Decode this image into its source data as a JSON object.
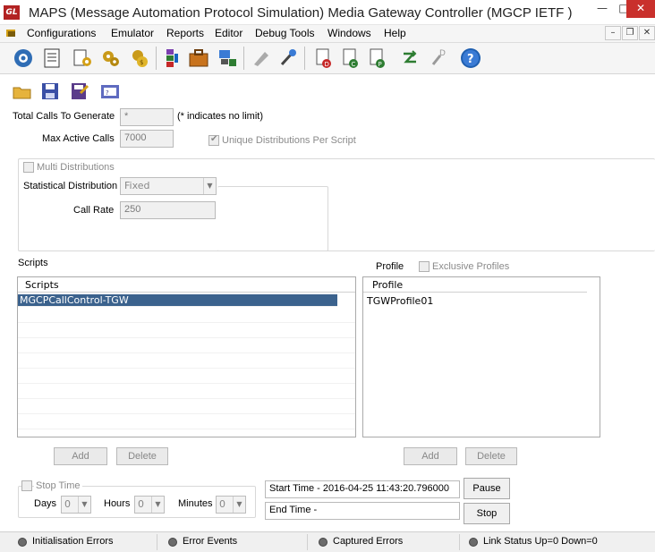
{
  "window": {
    "title": "MAPS (Message Automation Protocol Simulation) Media Gateway Controller (MGCP IETF )",
    "logo_text": "GL",
    "min": "—",
    "max": "□",
    "close": "✕"
  },
  "menu": {
    "items": [
      "Configurations",
      "Emulator",
      "Reports",
      "Editor",
      "Debug Tools",
      "Windows",
      "Help"
    ],
    "mdi_min": "–",
    "mdi_restore": "❐",
    "mdi_close": "✕"
  },
  "toolbar": {
    "icons": [
      "settings-gear-icon",
      "script-document-icon",
      "edit-script-icon",
      "gears-icon",
      "coins-gears-icon",
      "profile-blocks-icon",
      "briefcase-icon",
      "network-lock-icon",
      "pen-disabled-icon",
      "tools-icon",
      "doc-d-icon",
      "doc-c-icon",
      "doc-p-icon",
      "refresh-z-icon",
      "wrench-d-icon",
      "help-icon"
    ]
  },
  "subtoolbar": {
    "icons": [
      "open-folder-icon",
      "save-icon",
      "save-as-icon",
      "film-script-icon"
    ]
  },
  "form": {
    "total_calls_label": "Total Calls To Generate",
    "total_calls_value": "*",
    "no_limit_note": "(* indicates no limit)",
    "max_active_label": "Max Active Calls",
    "max_active_value": "7000",
    "unique_dist_label": "Unique Distributions Per Script",
    "multi_dist_label": "Multi Distributions",
    "stat_dist_label": "Statistical Distribution",
    "stat_dist_value": "Fixed",
    "call_rate_label": "Call Rate",
    "call_rate_value": "250"
  },
  "scripts": {
    "section_label": "Scripts",
    "column_header": "Scripts",
    "rows": [
      "MGCPCallControl-TGW"
    ],
    "add_label": "Add",
    "delete_label": "Delete"
  },
  "profiles": {
    "section_label": "Profile",
    "exclusive_label": "Exclusive Profiles",
    "column_header": "Profile",
    "rows": [
      "TGWProfile01"
    ],
    "add_label": "Add",
    "delete_label": "Delete"
  },
  "timing": {
    "stop_time_label": "Stop Time",
    "days_label": "Days",
    "days_value": "0",
    "hours_label": "Hours",
    "hours_value": "0",
    "minutes_label": "Minutes",
    "minutes_value": "0",
    "start_time": "Start Time - 2016-04-25 11:43:20.796000",
    "end_time": "End Time  -",
    "pause_label": "Pause",
    "stop_label": "Stop"
  },
  "status": {
    "items": [
      "Initialisation Errors",
      "Error Events",
      "Captured Errors",
      "Link Status Up=0 Down=0"
    ]
  },
  "colors": {
    "selection": "#3b628d",
    "close_button": "#c9302c",
    "logo": "#b22222"
  }
}
